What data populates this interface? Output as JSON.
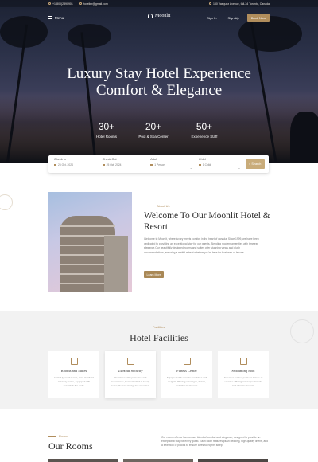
{
  "topbar": {
    "phone": "+1(800)2390901",
    "email": "hotelier@gmail.com",
    "address": "180 Vasquez Avenue, fall-34 Toronto, Canada"
  },
  "nav": {
    "menu_label": "Menu",
    "brand": "Moonlit",
    "signin": "Sign In",
    "signup": "Sign Up",
    "book_now": "Book Now"
  },
  "hero": {
    "title_line1": "Luxury Stay Hotel Experience",
    "title_line2": "Comfort & Elegance",
    "stats": [
      {
        "value": "30+",
        "label": "Hotel Rooms"
      },
      {
        "value": "20+",
        "label": "Pool & Spa Center"
      },
      {
        "value": "50+",
        "label": "Experience Staff"
      }
    ]
  },
  "booking": {
    "checkin_label": "Check In",
    "checkin_value": "25 Oct, 2024",
    "checkout_label": "Check Out",
    "checkout_value": "25 Oct, 2024",
    "adult_label": "Adult",
    "adult_value": "1 Person",
    "child_label": "Child",
    "child_value": "1 Child",
    "search_label": "Search"
  },
  "about": {
    "eyebrow": "About Us",
    "title": "Welcome To Our Moonlit Hotel & Resort",
    "text": "Welcome to Moonlit, where luxury meets comfort in the heart of canada. Since 1999, we have been dedicated to providing an exceptional stay for our guests. Blending modern amenities with timeless elegance.Our beautifully designed rooms and suites offer stunning views and plush accommodations, ensuring a restful retreat whether you're here for business or leisure.",
    "button": "Learn More"
  },
  "facilities": {
    "eyebrow": "Facilities",
    "title": "Hotel Facilities",
    "items": [
      {
        "name": "Rooms and Suites",
        "desc": "Varied types of rooms, from standard to luxury suites, equipped with essentials like beds."
      },
      {
        "name": "24-Hour Security",
        "desc": "On-site security personnel and surveillance, from standard to luxury suites, Secure storage for valuables."
      },
      {
        "name": "Fitness Center",
        "desc": "Equipped with exercise machines and weights. Offering massages, facials, and other treatments."
      },
      {
        "name": "Swimming Pool",
        "desc": "Indoor or outdoor pools for leisure or exercise offering massages, facials, and other treatments."
      }
    ]
  },
  "rooms": {
    "eyebrow": "Room",
    "title": "Our Rooms",
    "text": "Our rooms offer a harmonious blend of comfort and elegance, designed to provide an exceptional stay for every guest. Each room features plush bedding, high-quality linens, and a selection of pillows to ensure a restful night's sleep."
  }
}
